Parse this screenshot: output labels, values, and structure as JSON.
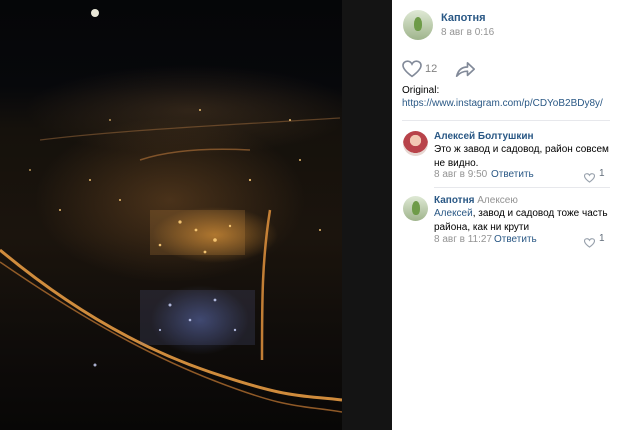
{
  "post": {
    "author": "Капотня",
    "date": "8 авг в 0:16",
    "likes": "12",
    "original_label": "Original:",
    "original_link": "https://www.instagram.com/p/CDYoB2BDy8y/"
  },
  "comments": [
    {
      "author": "Алексей Болтушкин",
      "reply_to": "",
      "mention": "",
      "text": "Это ж завод и садовод, район совсем не видно.",
      "date": "8 авг в 9:50",
      "reply_label": "Ответить",
      "likes": "1"
    },
    {
      "author": "Капотня",
      "reply_to": "Алексею",
      "mention": "Алексей",
      "text": ", завод и садовод тоже часть района, как ни крути",
      "date": "8 авг в 11:27",
      "reply_label": "Ответить",
      "likes": "1"
    }
  ],
  "icons": {
    "like": "heart-icon",
    "share": "share-arrow-icon",
    "comment_like": "heart-icon"
  },
  "colors": {
    "link": "#2a5885",
    "muted": "#939393",
    "background": "#ffffff"
  }
}
